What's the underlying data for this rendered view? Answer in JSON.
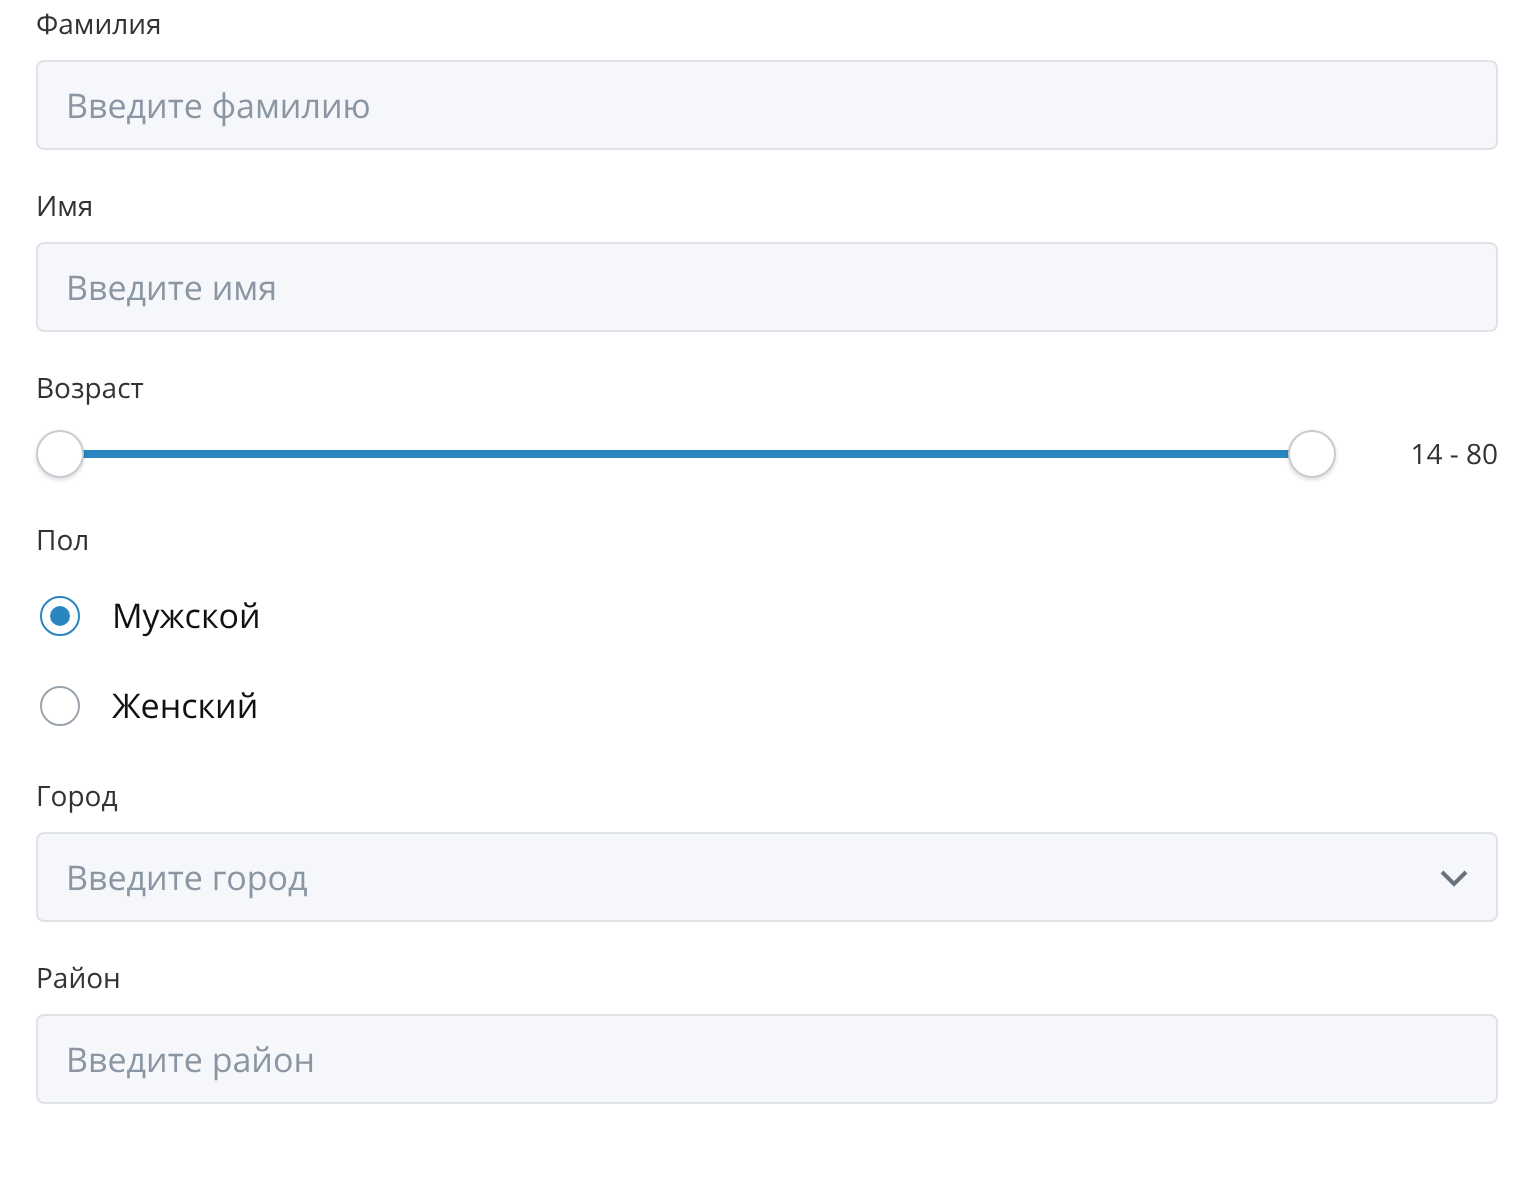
{
  "fields": [
    {
      "kind": "text",
      "label": "Фамилия",
      "placeholder": "Введите фамилию"
    },
    {
      "kind": "text",
      "label": "Имя",
      "placeholder": "Введите имя"
    },
    {
      "kind": "range",
      "label": "Возраст",
      "thumbs": [
        {
          "level": 0
        },
        {
          "level": 1
        }
      ],
      "reading": "14 - 80"
    },
    {
      "kind": "radio",
      "label": "Пол",
      "options": [
        {
          "label": "Мужской",
          "selected": true
        },
        {
          "label": "Женский",
          "selected": false
        }
      ]
    },
    {
      "kind": "select",
      "label": "Город",
      "placeholder": "Введите город"
    },
    {
      "kind": "text",
      "label": "Район",
      "placeholder": "Введите район"
    }
  ]
}
